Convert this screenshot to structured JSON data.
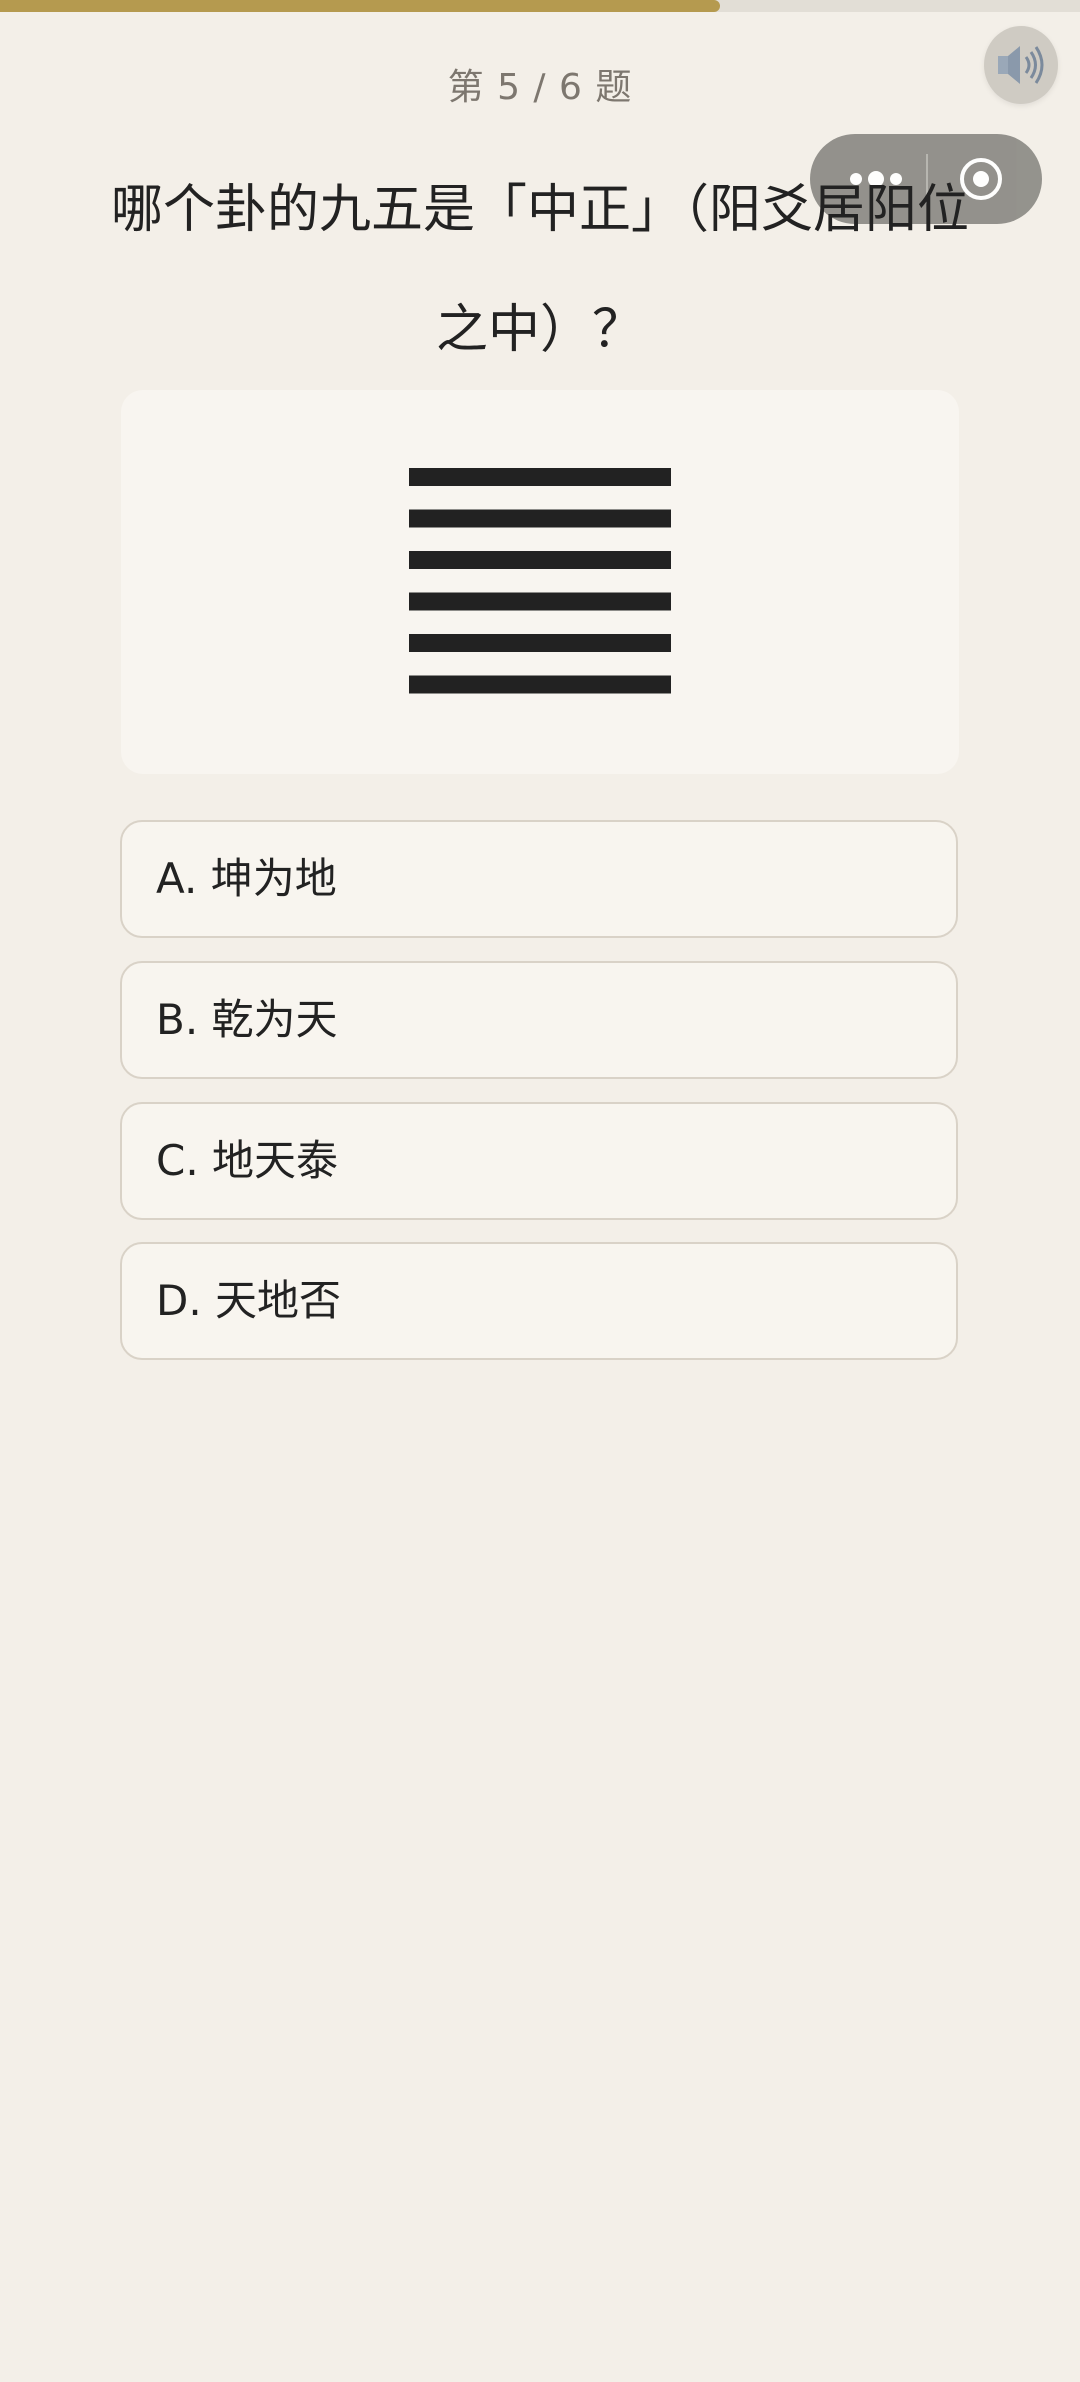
{
  "progress": {
    "fraction": 0.667
  },
  "header": {
    "counter": "第 5 / 6 题"
  },
  "icons": {
    "sound": "speaker-icon",
    "more": "more-dots-icon",
    "close": "record-circle-icon"
  },
  "question": {
    "text": "哪个卦的九五是「中正」（阳爻居阳位之中）？"
  },
  "hexagram": {
    "lines": [
      "yang",
      "yang",
      "yang",
      "yang",
      "yang",
      "yang"
    ]
  },
  "options": [
    {
      "label": "A. 坤为地"
    },
    {
      "label": "B. 乾为天"
    },
    {
      "label": "C. 地天泰"
    },
    {
      "label": "D. 天地否"
    }
  ],
  "colors": {
    "background": "#f3efe8",
    "progress_fill": "#b59a4f",
    "hex_line": "#222222"
  }
}
